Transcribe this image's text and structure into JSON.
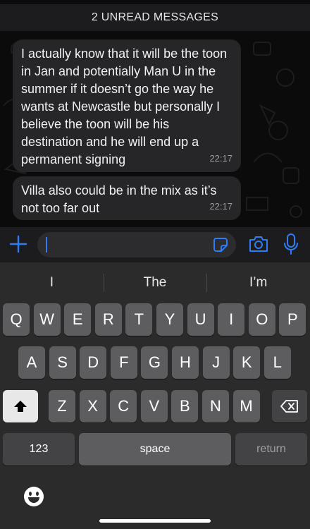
{
  "unread": {
    "label": "2 UNREAD MESSAGES"
  },
  "messages": [
    {
      "text": "I actually know that it will be the toon in Jan and potentially Man U in the summer if it doesn’t go the way he wants at Newcastle but personally I believe the toon will be his destination and he will end up a permanent signing",
      "time": "22:17"
    },
    {
      "text": "Villa also could be in the mix as it’s not too far out",
      "time": "22:17"
    }
  ],
  "input": {
    "value": "",
    "placeholder": ""
  },
  "suggestions": [
    "I",
    "The",
    "I’m"
  ],
  "keyboard": {
    "row1": [
      "Q",
      "W",
      "E",
      "R",
      "T",
      "Y",
      "U",
      "I",
      "O",
      "P"
    ],
    "row2": [
      "A",
      "S",
      "D",
      "F",
      "G",
      "H",
      "J",
      "K",
      "L"
    ],
    "row3": [
      "Z",
      "X",
      "C",
      "V",
      "B",
      "N",
      "M"
    ],
    "numbers_label": "123",
    "space_label": "space",
    "return_label": "return"
  },
  "icons": {
    "plus": "plus-icon",
    "sticker": "sticker-icon",
    "camera": "camera-icon",
    "mic": "microphone-icon",
    "shift": "shift-icon",
    "delete": "delete-icon",
    "emoji": "emoji-icon"
  },
  "colors": {
    "accent": "#2f7df6",
    "bubble": "#262628",
    "keyboard": "#2b2b2b"
  }
}
